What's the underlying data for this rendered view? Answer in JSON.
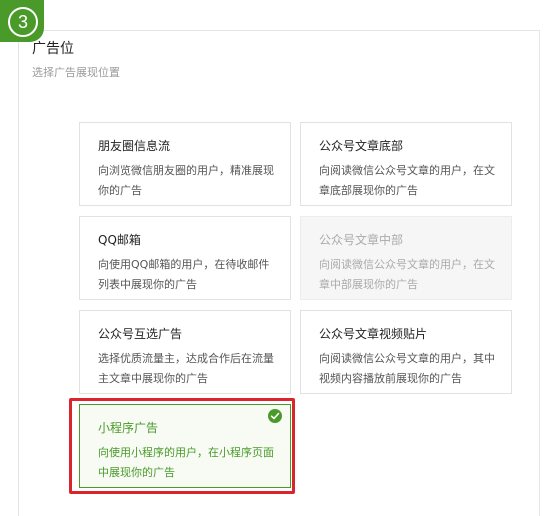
{
  "step_number": "3",
  "section": {
    "title": "广告位",
    "subtitle": "选择广告展现位置"
  },
  "cards": [
    {
      "title": "朋友圈信息流",
      "desc": "向浏览微信朋友圈的用户，精准展现你的广告"
    },
    {
      "title": "公众号文章底部",
      "desc": "向阅读微信公众号文章的用户，在文章底部展现你的广告"
    },
    {
      "title": "QQ邮箱",
      "desc": "向使用QQ邮箱的用户，在待收邮件列表中展现你的广告"
    },
    {
      "title": "公众号文章中部",
      "desc": "向阅读微信公众号文章的用户，在文章中部展现你的广告"
    },
    {
      "title": "公众号互选广告",
      "desc": "选择优质流量主，达成合作后在流量主文章中展现你的广告"
    },
    {
      "title": "公众号文章视频贴片",
      "desc": "向阅读微信公众号文章的用户，其中视频内容播放前展现你的广告"
    },
    {
      "title": "小程序广告",
      "desc": "向使用小程序的用户，在小程序页面中展现你的广告"
    }
  ],
  "colors": {
    "accent_green": "#4a9a2a",
    "highlight_red": "#d9262c"
  }
}
